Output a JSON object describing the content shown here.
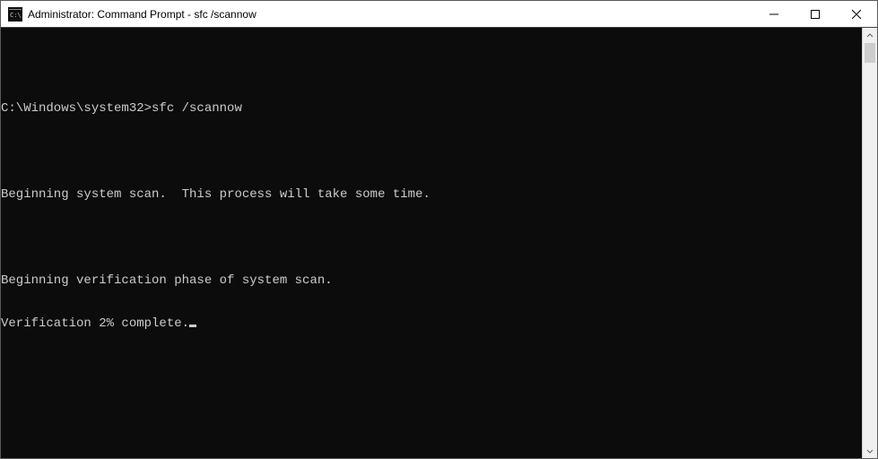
{
  "window": {
    "title": "Administrator: Command Prompt - sfc  /scannow"
  },
  "terminal": {
    "blank0": "",
    "line0": "C:\\Windows\\system32>sfc /scannow",
    "blank1": "",
    "line1": "Beginning system scan.  This process will take some time.",
    "blank2": "",
    "line2": "Beginning verification phase of system scan.",
    "line3": "Verification 2% complete."
  }
}
